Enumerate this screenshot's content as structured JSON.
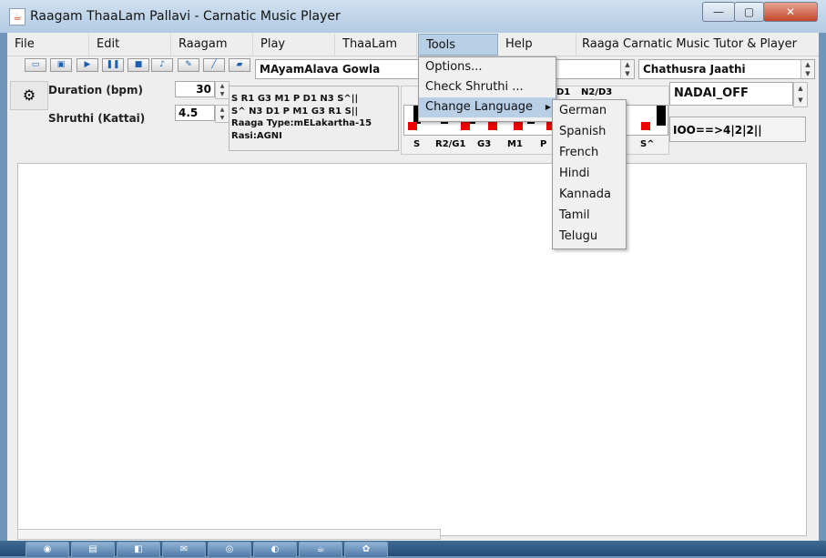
{
  "window": {
    "title": "Raagam ThaaLam Pallavi - Carnatic Music Player",
    "app_icon": "java-coffee-icon",
    "controls": {
      "minimize": "—",
      "maximize": "▢",
      "close": "✕"
    }
  },
  "menubar": {
    "items": [
      "File",
      "Edit",
      "Raagam",
      "Play",
      "ThaaLam",
      "Tools",
      "Help",
      "Raaga Carnatic Music Tutor & Player"
    ],
    "active_index": 5
  },
  "toolbar": {
    "buttons": [
      {
        "icon": "open-folder-icon",
        "glyph": "▭"
      },
      {
        "icon": "save-icon",
        "glyph": "▣"
      },
      {
        "icon": "play-icon",
        "glyph": "▶"
      },
      {
        "icon": "pause-icon",
        "glyph": "❚❚"
      },
      {
        "icon": "stop-icon",
        "glyph": "■"
      },
      {
        "icon": "instrument-icon",
        "glyph": "♪"
      },
      {
        "icon": "brush-icon",
        "glyph": "✎"
      },
      {
        "icon": "line-icon",
        "glyph": "╱"
      },
      {
        "icon": "eraser-icon",
        "glyph": "▰"
      }
    ]
  },
  "raagam_combo": {
    "value": "MAyamAlava Gowla"
  },
  "jaathi_combo": {
    "value": "Chathusra Jaathi"
  },
  "nadai_combo": {
    "value": "NADAI_OFF"
  },
  "thaalam_pattern": {
    "value": "IOO==>4|2|2||"
  },
  "controls": {
    "metronome_icon": "metronome-icon",
    "duration_label": "Duration (bpm)",
    "duration_value": "30",
    "shruthi_label": "Shruthi (Kattai)",
    "shruthi_value": "4.5"
  },
  "raga_info": {
    "arohanam": "S R1 G3 M1 P D1 N3 S^||",
    "avarohanam": "S^ N3 D1 P M1 G3 R1 S||",
    "raaga_type": "Raaga Type:mELakartha-15",
    "rasi": "Rasi:AGNI"
  },
  "keyboard": {
    "top_labels": [
      "D1",
      "N2/D3"
    ],
    "bottom_labels": [
      "S",
      "R2/G1",
      "G3",
      "M1",
      "P",
      "S^"
    ]
  },
  "tools_menu": {
    "items": [
      "Options...",
      "Check Shruthi ...",
      "Change Language"
    ],
    "submenu_arrow": "▶"
  },
  "language_submenu": {
    "items": [
      "German",
      "Spanish",
      "French",
      "Hindi",
      "Kannada",
      "Tamil",
      "Telugu"
    ]
  },
  "taskbar": {
    "items": [
      {
        "icon": "firefox-icon",
        "glyph": "◉"
      },
      {
        "icon": "folder-icon",
        "glyph": "▤"
      },
      {
        "icon": "python-icon",
        "glyph": "◧"
      },
      {
        "icon": "outlook-icon",
        "glyph": "✉"
      },
      {
        "icon": "tor-icon",
        "glyph": "◎"
      },
      {
        "icon": "eclipse-icon",
        "glyph": "◐"
      },
      {
        "icon": "java-icon",
        "glyph": "☕"
      },
      {
        "icon": "paint-icon",
        "glyph": "✿"
      }
    ]
  },
  "colors": {
    "menu_highlight": "#b9cfe6",
    "key_marker": "#ee0000",
    "title_gradient": "#bcd3ea"
  }
}
